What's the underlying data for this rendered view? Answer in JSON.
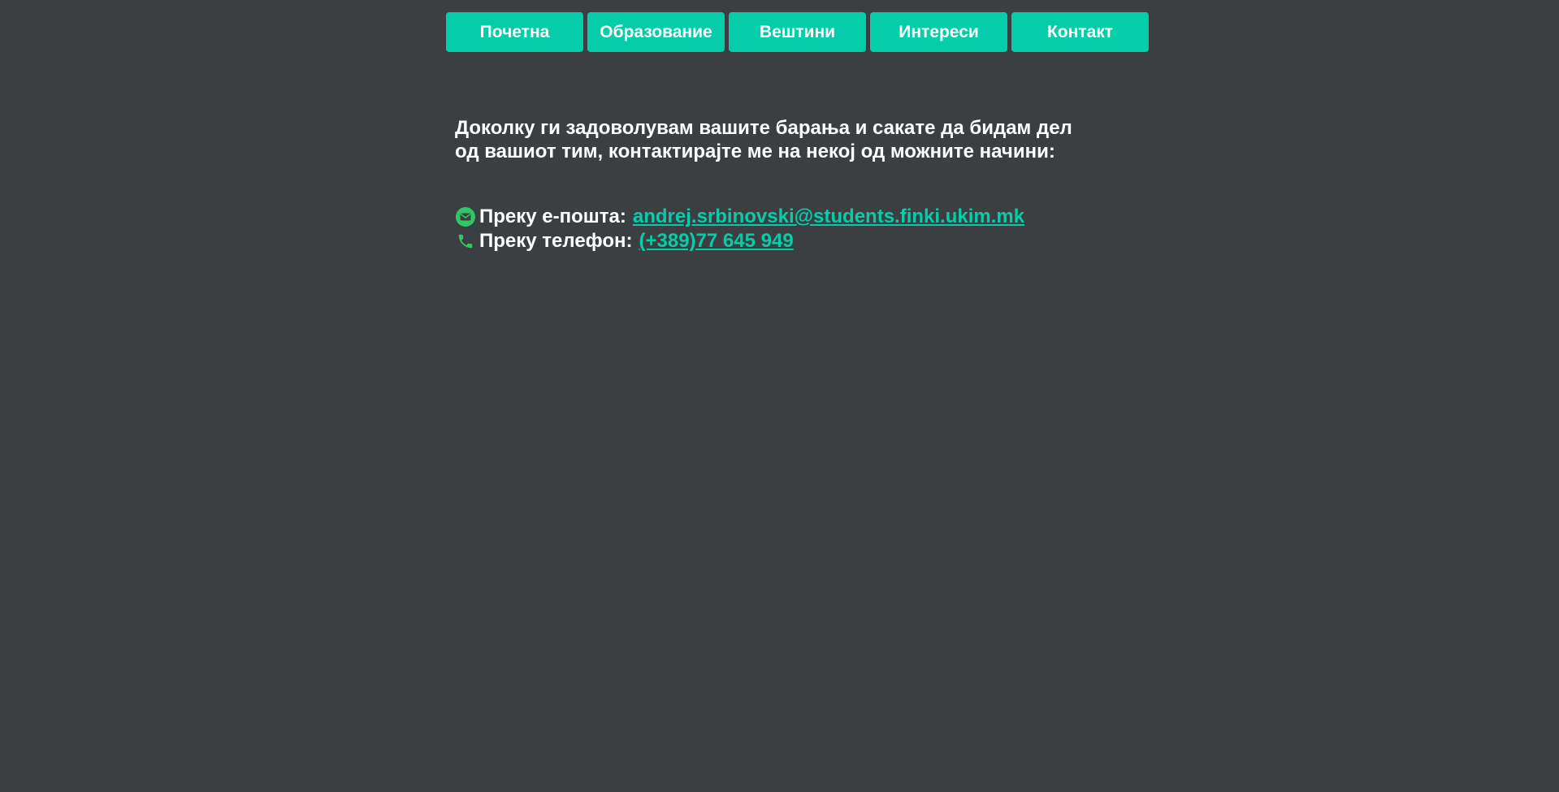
{
  "nav": {
    "items": [
      {
        "label": "Почетна"
      },
      {
        "label": "Образование"
      },
      {
        "label": "Вештини"
      },
      {
        "label": "Интереси"
      },
      {
        "label": "Контакт"
      }
    ]
  },
  "main": {
    "intro_line1": "Доколку ги задоволувам вашите барања и сакате да бидам дел",
    "intro_line2": "од вашиот тим, контактирајте ме на некој од можните начини:",
    "contacts": {
      "email": {
        "label": "Преку е-пошта:",
        "value": "andrej.srbinovski@students.finki.ukim.mk",
        "icon": "envelope-icon"
      },
      "phone": {
        "label": "Преку телефон:",
        "value": "(+389)77 645 949",
        "icon": "phone-icon"
      }
    }
  },
  "colors": {
    "background": "#3c3f42",
    "accent": "#05cca9",
    "icon_green": "#2fc766",
    "text": "#ffffff"
  }
}
